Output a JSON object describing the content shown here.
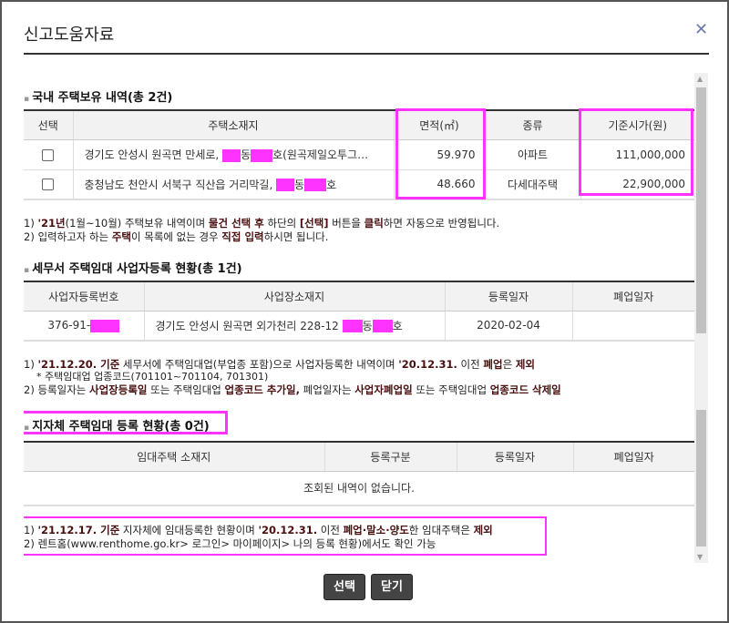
{
  "dialog": {
    "title": "신고도움자료",
    "close_icon": "close-icon"
  },
  "section1": {
    "heading": "국내 주택보유 내역(총 2건)",
    "headers": [
      "선택",
      "주택소재지",
      "면적(㎡)",
      "종류",
      "기준시가(원)"
    ],
    "rows": [
      {
        "addr_a": "경기도 안성시 원곡면 만세로,",
        "addr_b": "동",
        "addr_c": "호(원곡제일오투그…",
        "area": "59.970",
        "type": "아파트",
        "price": "111,000,000"
      },
      {
        "addr_a": "충청남도 천안시 서북구 직산읍 거리막길,",
        "addr_b": "동",
        "addr_c": "호",
        "area": "48.660",
        "type": "다세대주택",
        "price": "22,900,000"
      }
    ],
    "notes": [
      [
        "1) ",
        "'21년",
        "(1월~10월) 주택보유 내역이며 ",
        "물건 선택 후",
        " 하단의 ",
        "[선택]",
        " 버튼을 ",
        "클릭",
        "하면 자동으로 반영됩니다."
      ],
      [
        "2) 입력하고자 하는 ",
        "주택",
        "이 목록에 없는 경우 ",
        "직접 입력",
        "하시면 됩니다."
      ]
    ]
  },
  "section2": {
    "heading": "세무서 주택임대 사업자등록 현황(총 1건)",
    "headers": [
      "사업자등록번호",
      "사업장소재지",
      "등록일자",
      "폐업일자"
    ],
    "row": {
      "bizno": "376-91-",
      "addr_a": "경기도 안성시 원곡면 외가천리 228-12",
      "addr_b": "동",
      "addr_c": "호",
      "reg_date": "2020-02-04",
      "close_date": ""
    },
    "notes": [
      [
        "1) ",
        "'21.12.20. 기준",
        " 세무서에 주택임대업(부업종 포함)으로 사업자등록한 내역이며 ",
        "'20.12.31.",
        " 이전 ",
        "폐업",
        "은 ",
        "제외"
      ],
      [
        "    * 주택임대업 업종코드(701101~701104, 701301)"
      ],
      [
        "2) 등록일자는 ",
        "사업장등록일",
        " 또는 주택임대업 ",
        "업종코드 추가일,",
        " 폐업일자는 ",
        "사업자폐업일",
        " 또는 주택임대업 ",
        "업종코드 삭제일"
      ]
    ]
  },
  "section3": {
    "heading": "지자체 주택임대 등록 현황(총 0건)",
    "headers": [
      "임대주택 소재지",
      "등록구분",
      "등록일자",
      "폐업일자"
    ],
    "empty": "조회된 내역이 없습니다.",
    "notes": [
      [
        "1) ",
        "'21.12.17. 기준",
        " 지자체에 임대등록한 현황이며 ",
        "'20.12.31.",
        " 이전 ",
        "폐업·말소·양도",
        "한 임대주택은 ",
        "제외"
      ],
      [
        "2) 렌트홈(www.renthome.go.kr> 로그인> 마이페이지> 나의 등록 현황)에서도 확인 가능"
      ]
    ]
  },
  "buttons": {
    "select": "선택",
    "close": "닫기"
  }
}
